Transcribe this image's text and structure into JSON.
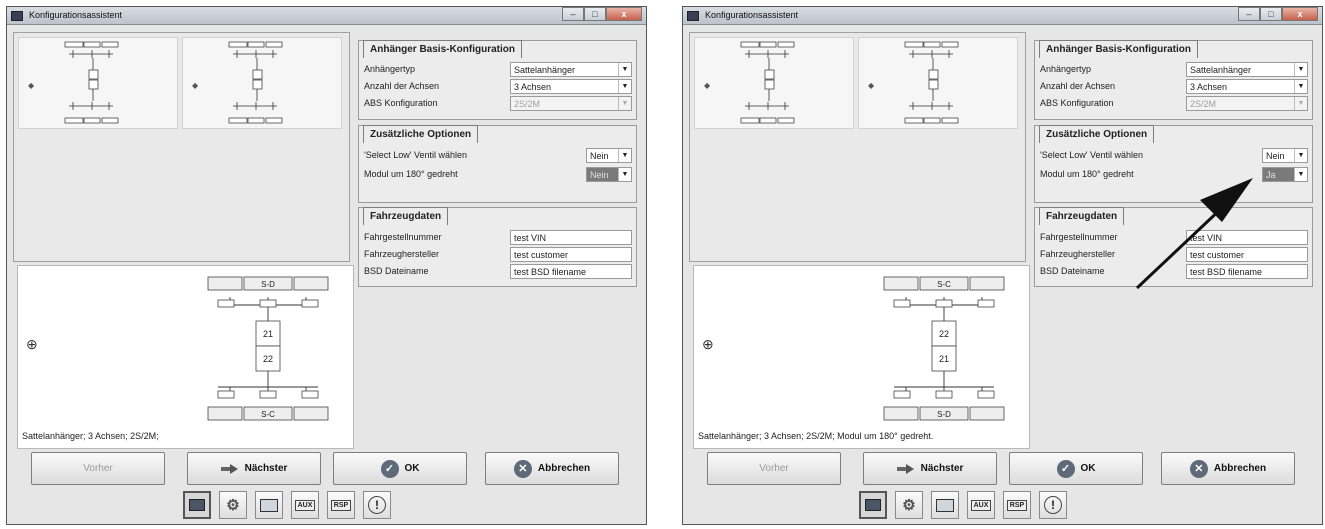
{
  "windows": [
    {
      "title": "Konfigurationsassistent",
      "basis": {
        "header": "Anhänger Basis-Konfiguration",
        "rows": [
          {
            "label": "Anhängertyp",
            "value": "Sattelanhänger",
            "disabled": false
          },
          {
            "label": "Anzahl der Achsen",
            "value": "3 Achsen",
            "disabled": false
          },
          {
            "label": "ABS Konfiguration",
            "value": "2S/2M",
            "disabled": true
          }
        ]
      },
      "options": {
        "header": "Zusätzliche Optionen",
        "rows": [
          {
            "label": "'Select Low' Ventil wählen",
            "value": "Nein",
            "highlight": false
          },
          {
            "label": "Modul um 180° gedreht",
            "value": "Nein",
            "highlight": true
          }
        ]
      },
      "vehicle": {
        "header": "Fahrzeugdaten",
        "rows": [
          {
            "label": "Fahrgestellnummer",
            "value": "test VIN"
          },
          {
            "label": "Fahrzeughersteller",
            "value": "test customer"
          },
          {
            "label": "BSD Dateiname",
            "value": "test BSD filename"
          }
        ]
      },
      "diagram": {
        "top_label": "S-D",
        "bottom_label": "S-C",
        "module_top": "21",
        "module_bottom": "22"
      },
      "config_text": "Sattelanhänger; 3 Achsen; 2S/2M;",
      "buttons": {
        "prev": "Vorher",
        "next": "Nächster",
        "ok": "OK",
        "cancel": "Abbrechen"
      },
      "toolbar": [
        "AUX",
        "RSP",
        "!"
      ]
    },
    {
      "title": "Konfigurationsassistent",
      "basis": {
        "header": "Anhänger Basis-Konfiguration",
        "rows": [
          {
            "label": "Anhängertyp",
            "value": "Sattelanhänger",
            "disabled": false
          },
          {
            "label": "Anzahl der Achsen",
            "value": "3 Achsen",
            "disabled": false
          },
          {
            "label": "ABS Konfiguration",
            "value": "2S/2M",
            "disabled": true
          }
        ]
      },
      "options": {
        "header": "Zusätzliche Optionen",
        "rows": [
          {
            "label": "'Select Low' Ventil wählen",
            "value": "Nein",
            "highlight": false
          },
          {
            "label": "Modul um 180° gedreht",
            "value": "Ja",
            "highlight": true
          }
        ]
      },
      "vehicle": {
        "header": "Fahrzeugdaten",
        "rows": [
          {
            "label": "Fahrgestellnummer",
            "value": "test VIN"
          },
          {
            "label": "Fahrzeughersteller",
            "value": "test customer"
          },
          {
            "label": "BSD Dateiname",
            "value": "test BSD filename"
          }
        ]
      },
      "diagram": {
        "top_label": "S-C",
        "bottom_label": "S-D",
        "module_top": "22",
        "module_bottom": "21"
      },
      "config_text": "Sattelanhänger; 3 Achsen; 2S/2M; Modul um 180° gedreht.",
      "buttons": {
        "prev": "Vorher",
        "next": "Nächster",
        "ok": "OK",
        "cancel": "Abbrechen"
      },
      "toolbar": [
        "AUX",
        "RSP",
        "!"
      ]
    }
  ]
}
